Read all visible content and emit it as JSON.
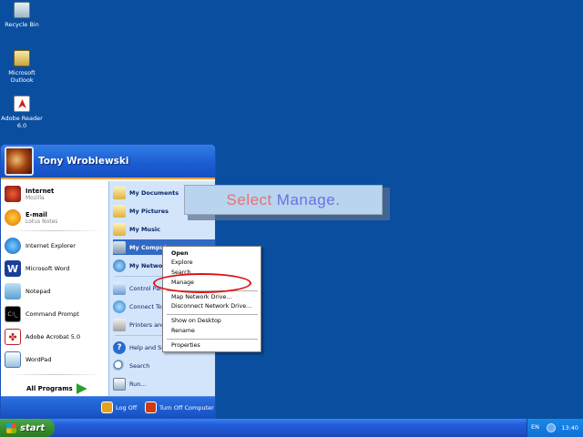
{
  "desktop": {
    "icons": [
      {
        "label": "Recycle Bin",
        "icon": "recycle-bin-icon"
      },
      {
        "label": "Microsoft Outlook",
        "icon": "outlook-icon"
      },
      {
        "label": "Adobe Reader 6.0",
        "icon": "adobe-reader-icon"
      }
    ]
  },
  "start_menu": {
    "user_name": "Tony Wroblewski",
    "pinned": [
      {
        "title": "Internet",
        "subtitle": "Mozilla",
        "icon": "mozilla-icon"
      },
      {
        "title": "E-mail",
        "subtitle": "Lotus Notes",
        "icon": "lotus-notes-icon"
      }
    ],
    "recent": [
      {
        "label": "Internet Explorer",
        "icon": "internet-explorer-icon"
      },
      {
        "label": "Microsoft Word",
        "icon": "word-icon"
      },
      {
        "label": "Notepad",
        "icon": "notepad-icon"
      },
      {
        "label": "Command Prompt",
        "icon": "command-prompt-icon"
      },
      {
        "label": "Adobe Acrobat 5.0",
        "icon": "acrobat-icon"
      },
      {
        "label": "WordPad",
        "icon": "wordpad-icon"
      }
    ],
    "all_programs": "All Programs",
    "places": [
      {
        "label": "My Documents",
        "icon": "my-documents-icon"
      },
      {
        "label": "My Pictures",
        "icon": "my-pictures-icon"
      },
      {
        "label": "My Music",
        "icon": "my-music-icon"
      },
      {
        "label": "My Computer",
        "icon": "my-computer-icon"
      },
      {
        "label": "My Network Places",
        "icon": "network-places-icon"
      }
    ],
    "system": [
      {
        "label": "Control Panel",
        "icon": "control-panel-icon"
      },
      {
        "label": "Connect To",
        "icon": "connect-to-icon"
      },
      {
        "label": "Printers and Faxes",
        "icon": "printers-icon"
      }
    ],
    "tools": [
      {
        "label": "Help and Support",
        "icon": "help-icon"
      },
      {
        "label": "Search",
        "icon": "search-icon"
      },
      {
        "label": "Run...",
        "icon": "run-icon"
      }
    ],
    "log_off": "Log Off",
    "turn_off": "Turn Off Computer"
  },
  "context_menu": {
    "items": [
      "Open",
      "Explore",
      "Search...",
      "Manage",
      "Map Network Drive...",
      "Disconnect Network Drive...",
      "Show on Desktop",
      "Rename",
      "Properties"
    ]
  },
  "callout": {
    "word1": "Select",
    "word2": "Manage."
  },
  "taskbar": {
    "start_label": "start",
    "language": "EN",
    "clock": "13:40"
  },
  "colors": {
    "desktop": "#0a4ea0",
    "highlight": "#316ac5",
    "annotation": "#e01010"
  }
}
